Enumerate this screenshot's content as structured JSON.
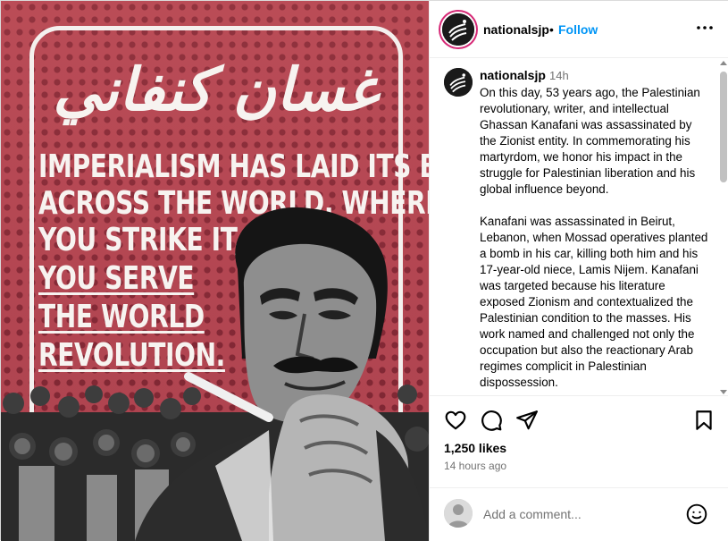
{
  "post": {
    "image": {
      "arabic_title": "غسان كنفاني",
      "quote_lines": [
        "IMPERIALISM HAS LAID ITS BODY",
        "ACROSS THE WORLD, WHEREVER",
        "YOU STRIKE IT,",
        "YOU SERVE",
        "THE WORLD",
        "REVOLUTION."
      ]
    },
    "header": {
      "username": "nationalsjp",
      "separator": "•",
      "follow_label": "Follow",
      "more_icon": "more-horizontal-icon"
    },
    "caption": {
      "username": "nationalsjp",
      "time": "14h",
      "paragraphs": [
        "On this day, 53 years ago, the Palestinian revolutionary, writer, and intellectual Ghassan Kanafani was assassinated by the Zionist entity. In commemorating his martyrdom, we honor his impact in the struggle for Palestinian liberation and his global influence beyond.",
        "Kanafani was assassinated in Beirut, Lebanon, when Mossad operatives planted a bomb in his car, killing both him and his 17-year-old niece, Lamis Nijem. Kanafani was targeted because his literature exposed Zionism and contextualized the Palestinian condition to the masses. His work named and challenged not only the occupation but also the reactionary Arab regimes complicit in Palestinian dispossession."
      ]
    },
    "actions": {
      "like_icon": "heart-icon",
      "comment_icon": "comment-icon",
      "share_icon": "share-icon",
      "save_icon": "bookmark-icon"
    },
    "likes": "1,250 likes",
    "posted": "14 hours ago",
    "comment_box": {
      "placeholder": "Add a comment...",
      "emoji_icon": "emoji-icon"
    },
    "colors": {
      "accent": "#0095f6",
      "poster_red": "#b84a55",
      "muted_text": "#737373"
    }
  }
}
